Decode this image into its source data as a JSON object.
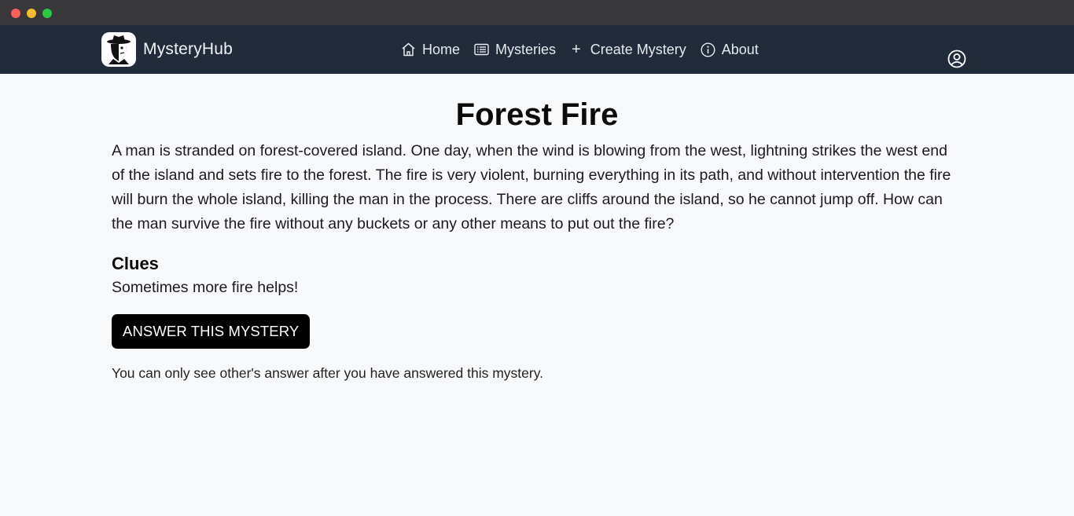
{
  "window": {
    "controls": [
      "close",
      "minimize",
      "maximize"
    ]
  },
  "navbar": {
    "brand": "MysteryHub",
    "links": [
      {
        "label": "Home",
        "icon": "home-icon"
      },
      {
        "label": "Mysteries",
        "icon": "list-icon"
      },
      {
        "label": "Create Mystery",
        "icon": "plus-icon",
        "glyph": "+"
      },
      {
        "label": "About",
        "icon": "info-icon"
      }
    ],
    "user_icon": "user-circle-icon"
  },
  "mystery": {
    "title": "Forest Fire",
    "description": "A man is stranded on forest-covered island. One day, when the wind is blowing from the west, lightning strikes the west end of the island and sets fire to the forest. The fire is very violent, burning everything in its path, and without intervention the fire will burn the whole island, killing the man in the process. There are cliffs around the island, so he cannot jump off. How can the man survive the fire without any buckets or any other means to put out the fire?",
    "clues_heading": "Clues",
    "clue": "Sometimes more fire helps!",
    "answer_button": "ANSWER THIS MYSTERY",
    "note": "You can only see other's answer after you have answered this mystery."
  },
  "colors": {
    "navbar_bg": "#222b39",
    "page_bg": "#f8f9fb",
    "button_bg": "#000000"
  }
}
